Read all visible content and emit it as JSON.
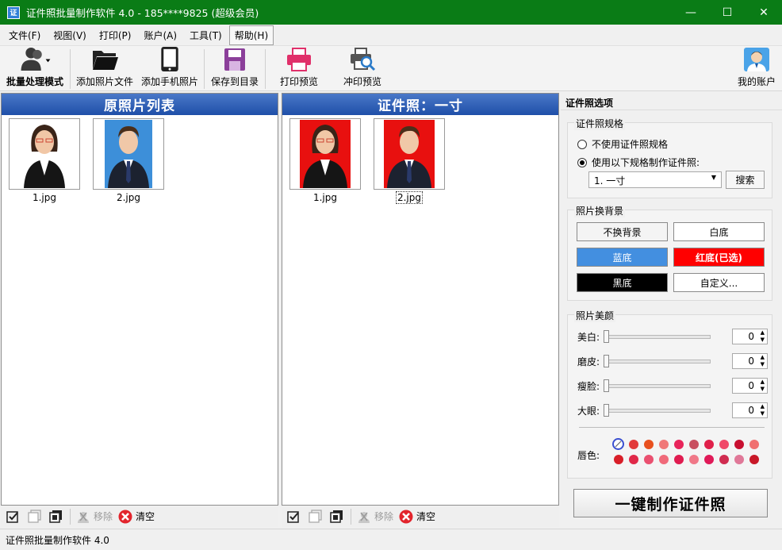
{
  "window": {
    "title": "证件照批量制作软件 4.0 - 185****9825 (超级会员)",
    "app_icon_text": "证",
    "controls": {
      "minimize": "—",
      "maximize": "☐",
      "close": "✕"
    }
  },
  "menu": {
    "items": [
      "文件(F)",
      "视图(V)",
      "打印(P)",
      "账户(A)",
      "工具(T)",
      "帮助(H)"
    ],
    "active_index": 5
  },
  "toolbar": {
    "batch_mode": "批量处理模式",
    "add_photo": "添加照片文件",
    "add_phone": "添加手机照片",
    "save_dir": "保存到目录",
    "print_preview": "打印预览",
    "develop_preview": "冲印预览",
    "my_account": "我的账户"
  },
  "left_panel": {
    "title": "原照片列表",
    "photos": [
      {
        "name": "1.jpg",
        "bg_color": "#ffffff",
        "gender": "female"
      },
      {
        "name": "2.jpg",
        "bg_color": "#3d8fd9",
        "gender": "male"
      }
    ],
    "actions": {
      "remove": "移除",
      "clear": "清空"
    }
  },
  "mid_panel": {
    "title": "证件照：一寸",
    "photos": [
      {
        "name": "1.jpg",
        "bg_color": "#e8100f",
        "gender": "female"
      },
      {
        "name": "2.jpg",
        "bg_color": "#e8100f",
        "gender": "male"
      }
    ],
    "actions": {
      "remove": "移除",
      "clear": "清空"
    }
  },
  "options": {
    "title": "证件照选项",
    "spec": {
      "title": "证件照规格",
      "option_none": "不使用证件照规格",
      "option_use": "使用以下规格制作证件照:",
      "selected_option": "use",
      "size_select": "1. 一寸",
      "search_button": "搜索"
    },
    "background": {
      "title": "照片换背景",
      "buttons": [
        {
          "label": "不换背景",
          "bg": "#f4f4f4",
          "fg": "#000000"
        },
        {
          "label": "白底",
          "bg": "#ffffff",
          "fg": "#000000"
        },
        {
          "label": "蓝底",
          "bg": "#438fe0",
          "fg": "#ffffff"
        },
        {
          "label": "红底(已选)",
          "bg": "#ff0000",
          "fg": "#ffffff"
        },
        {
          "label": "黑底",
          "bg": "#000000",
          "fg": "#ffffff"
        },
        {
          "label": "自定义...",
          "bg": "#ffffff",
          "fg": "#000000"
        }
      ]
    },
    "beauty": {
      "title": "照片美颜",
      "sliders": [
        {
          "label": "美白:",
          "value": "0"
        },
        {
          "label": "磨皮:",
          "value": "0"
        },
        {
          "label": "瘦脸:",
          "value": "0"
        },
        {
          "label": "大眼:",
          "value": "0"
        }
      ],
      "lip_label": "唇色:",
      "lip_colors": [
        "none",
        "#e23a3a",
        "#e8501e",
        "#f07878",
        "#e8245a",
        "#c85060",
        "#e0204a",
        "#f04868",
        "#c80f30",
        "#f07070",
        "#d81e28",
        "#e02848",
        "#ea5070",
        "#f06a7a",
        "#e01c50",
        "#f07888",
        "#e01a58",
        "#d02c50",
        "#e07898",
        "#c81828"
      ]
    },
    "make_button": "一键制作证件照"
  },
  "status": {
    "text": "证件照批量制作软件 4.0"
  }
}
